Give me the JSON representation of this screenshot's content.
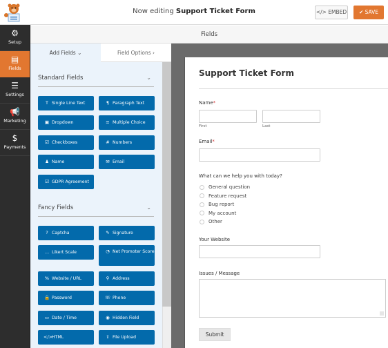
{
  "topbar": {
    "title_prefix": "Now editing",
    "form_name": "Support Ticket Form",
    "embed_label": "EMBED",
    "embed_icon": "</>",
    "save_label": "SAVE",
    "save_icon": "✔"
  },
  "colors": {
    "accent": "#e27730",
    "field_button": "#036aab",
    "nav_bg": "#2d2d2d",
    "panel_bg": "#ebf3fb",
    "preview_bg": "#6b6b6b"
  },
  "nav": [
    {
      "label": "Setup",
      "icon": "gear-icon",
      "glyph": "⚙",
      "active": false
    },
    {
      "label": "Fields",
      "icon": "fields-icon",
      "glyph": "▤",
      "active": true
    },
    {
      "label": "Settings",
      "icon": "sliders-icon",
      "glyph": "☰",
      "active": false
    },
    {
      "label": "Marketing",
      "icon": "megaphone-icon",
      "glyph": "📢",
      "active": false
    },
    {
      "label": "Payments",
      "icon": "dollar-icon",
      "glyph": "$",
      "active": false
    }
  ],
  "fields_header": "Fields",
  "tabs": {
    "add_fields": "Add Fields ⌄",
    "field_options": "Field Options ›"
  },
  "standard_fields": {
    "title": "Standard Fields",
    "items": [
      {
        "label": "Single Line Text",
        "glyph": "T"
      },
      {
        "label": "Paragraph Text",
        "glyph": "¶"
      },
      {
        "label": "Dropdown",
        "glyph": "▣"
      },
      {
        "label": "Multiple Choice",
        "glyph": "≡"
      },
      {
        "label": "Checkboxes",
        "glyph": "☑"
      },
      {
        "label": "Numbers",
        "glyph": "#"
      },
      {
        "label": "Name",
        "glyph": "♟"
      },
      {
        "label": "Email",
        "glyph": "✉"
      },
      {
        "label": "GDPR Agreement",
        "glyph": "☑"
      }
    ]
  },
  "fancy_fields": {
    "title": "Fancy Fields",
    "items": [
      {
        "label": "Captcha",
        "glyph": "?"
      },
      {
        "label": "Signature",
        "glyph": "✎"
      },
      {
        "label": "Likert Scale",
        "glyph": "…"
      },
      {
        "label": "Net Promoter Score",
        "glyph": "◔"
      },
      {
        "label": "Website / URL",
        "glyph": "%"
      },
      {
        "label": "Address",
        "glyph": "⚲"
      },
      {
        "label": "Password",
        "glyph": "🔒"
      },
      {
        "label": "Phone",
        "glyph": "☏"
      },
      {
        "label": "Date / Time",
        "glyph": "▭"
      },
      {
        "label": "Hidden Field",
        "glyph": "◉"
      },
      {
        "label": "HTML",
        "glyph": "</>"
      },
      {
        "label": "File Upload",
        "glyph": "⇪"
      }
    ]
  },
  "form": {
    "title": "Support Ticket Form",
    "name_label": "Name",
    "first_label": "First",
    "last_label": "Last",
    "email_label": "Email",
    "required_mark": "*",
    "question_label": "What can we help you with today?",
    "options": [
      "General question",
      "Feature request",
      "Bug report",
      "My account",
      "Other"
    ],
    "website_label": "Your Website",
    "message_label": "Issues / Message",
    "submit_label": "Submit"
  }
}
